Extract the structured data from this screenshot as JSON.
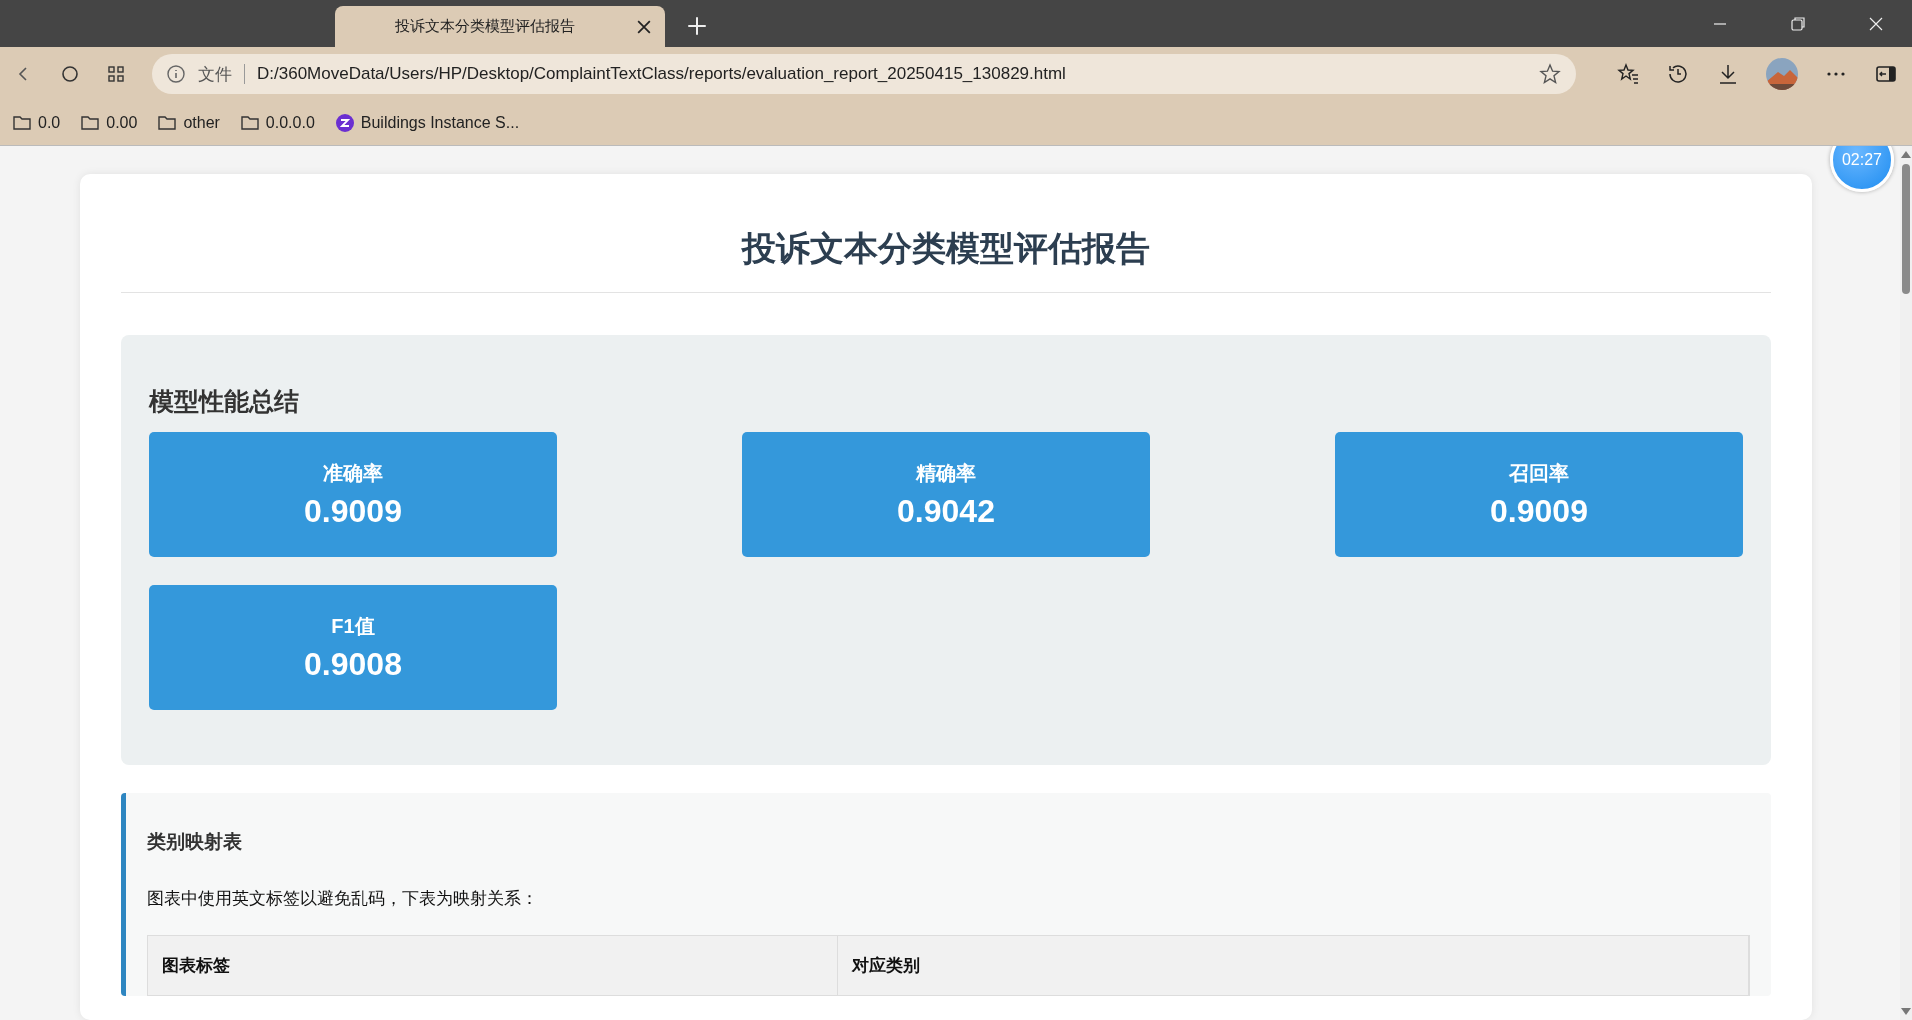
{
  "browser": {
    "tab_title": "投诉文本分类模型评估报告",
    "address_label": "文件",
    "url": "D:/360MoveData/Users/HP/Desktop/ComplaintTextClass/reports/evaluation_report_20250415_130829.html",
    "bookmarks": [
      {
        "kind": "folder",
        "label": "0.0"
      },
      {
        "kind": "folder",
        "label": "0.00"
      },
      {
        "kind": "folder",
        "label": "other"
      },
      {
        "kind": "folder",
        "label": "0.0.0.0"
      },
      {
        "kind": "site",
        "label": "Buildings Instance S..."
      }
    ]
  },
  "timer": "02:27",
  "report": {
    "title": "投诉文本分类模型评估报告",
    "summary": {
      "heading": "模型性能总结",
      "metrics": [
        {
          "label": "准确率",
          "value": "0.9009"
        },
        {
          "label": "精确率",
          "value": "0.9042"
        },
        {
          "label": "召回率",
          "value": "0.9009"
        },
        {
          "label": "F1值",
          "value": "0.9008"
        }
      ]
    },
    "mapping": {
      "heading": "类别映射表",
      "note": "图表中使用英文标签以避免乱码，下表为映射关系：",
      "columns": [
        "图表标签",
        "对应类别"
      ]
    }
  }
}
